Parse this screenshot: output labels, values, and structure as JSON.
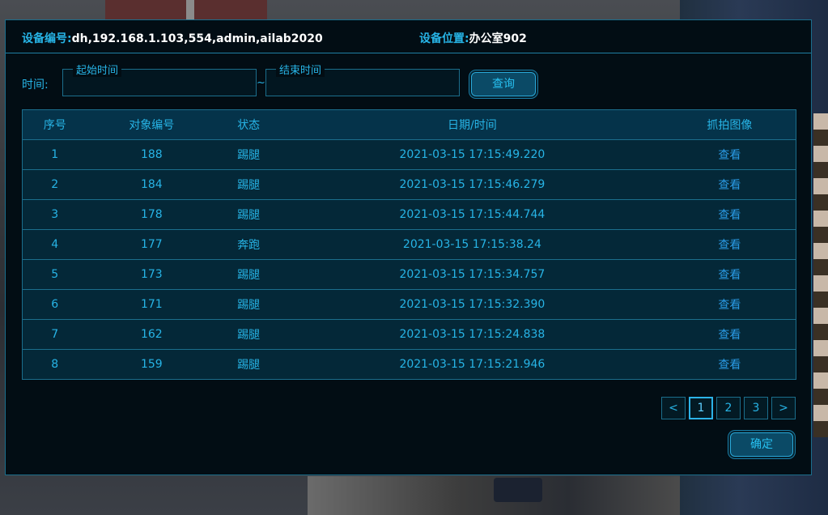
{
  "header": {
    "device_id_label": "设备编号:",
    "device_id_value": "dh,192.168.1.103,554,admin,ailab2020",
    "device_loc_label": "设备位置:",
    "device_loc_value": "办公室902"
  },
  "filter": {
    "time_label": "时间:",
    "start_legend": "起始时间",
    "start_value": "",
    "separator": "~",
    "end_legend": "结束时间",
    "end_value": "",
    "query_label": "查询"
  },
  "table": {
    "columns": [
      "序号",
      "对象编号",
      "状态",
      "日期/时间",
      "抓拍图像"
    ],
    "rows": [
      {
        "index": "1",
        "object_id": "188",
        "status": "踢腿",
        "datetime": "2021-03-15 17:15:49.220",
        "action": "查看"
      },
      {
        "index": "2",
        "object_id": "184",
        "status": "踢腿",
        "datetime": "2021-03-15 17:15:46.279",
        "action": "查看"
      },
      {
        "index": "3",
        "object_id": "178",
        "status": "踢腿",
        "datetime": "2021-03-15 17:15:44.744",
        "action": "查看"
      },
      {
        "index": "4",
        "object_id": "177",
        "status": "奔跑",
        "datetime": "2021-03-15 17:15:38.24",
        "action": "查看"
      },
      {
        "index": "5",
        "object_id": "173",
        "status": "踢腿",
        "datetime": "2021-03-15 17:15:34.757",
        "action": "查看"
      },
      {
        "index": "6",
        "object_id": "171",
        "status": "踢腿",
        "datetime": "2021-03-15 17:15:32.390",
        "action": "查看"
      },
      {
        "index": "7",
        "object_id": "162",
        "status": "踢腿",
        "datetime": "2021-03-15 17:15:24.838",
        "action": "查看"
      },
      {
        "index": "8",
        "object_id": "159",
        "status": "踢腿",
        "datetime": "2021-03-15 17:15:21.946",
        "action": "查看"
      }
    ]
  },
  "pager": {
    "prev": "<",
    "pages": [
      "1",
      "2",
      "3"
    ],
    "current": "1",
    "next": ">"
  },
  "footer": {
    "ok_label": "确定"
  },
  "colors": {
    "accent": "#27b4e6",
    "panel_bg": "#020d14",
    "border": "#1b6e8c"
  }
}
